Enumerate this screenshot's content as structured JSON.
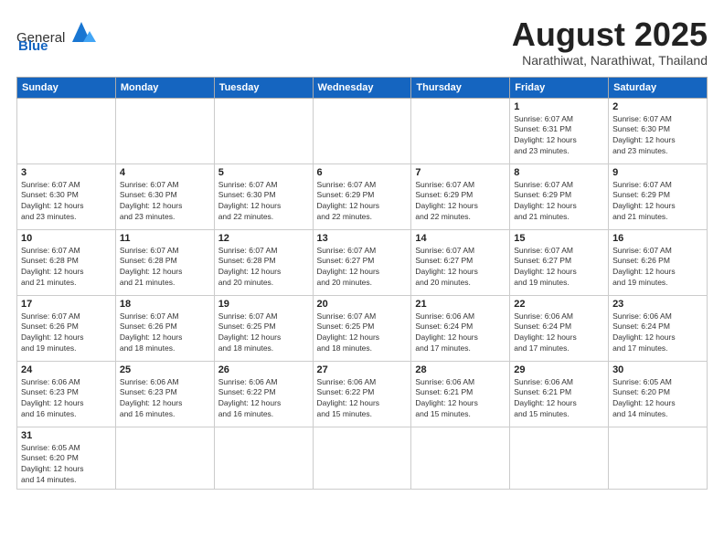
{
  "logo": {
    "text_general": "General",
    "text_blue": "Blue"
  },
  "title": {
    "month_year": "August 2025",
    "location": "Narathiwat, Narathiwat, Thailand"
  },
  "weekdays": [
    "Sunday",
    "Monday",
    "Tuesday",
    "Wednesday",
    "Thursday",
    "Friday",
    "Saturday"
  ],
  "weeks": [
    [
      {
        "day": "",
        "info": ""
      },
      {
        "day": "",
        "info": ""
      },
      {
        "day": "",
        "info": ""
      },
      {
        "day": "",
        "info": ""
      },
      {
        "day": "",
        "info": ""
      },
      {
        "day": "1",
        "info": "Sunrise: 6:07 AM\nSunset: 6:31 PM\nDaylight: 12 hours\nand 23 minutes."
      },
      {
        "day": "2",
        "info": "Sunrise: 6:07 AM\nSunset: 6:30 PM\nDaylight: 12 hours\nand 23 minutes."
      }
    ],
    [
      {
        "day": "3",
        "info": "Sunrise: 6:07 AM\nSunset: 6:30 PM\nDaylight: 12 hours\nand 23 minutes."
      },
      {
        "day": "4",
        "info": "Sunrise: 6:07 AM\nSunset: 6:30 PM\nDaylight: 12 hours\nand 23 minutes."
      },
      {
        "day": "5",
        "info": "Sunrise: 6:07 AM\nSunset: 6:30 PM\nDaylight: 12 hours\nand 22 minutes."
      },
      {
        "day": "6",
        "info": "Sunrise: 6:07 AM\nSunset: 6:29 PM\nDaylight: 12 hours\nand 22 minutes."
      },
      {
        "day": "7",
        "info": "Sunrise: 6:07 AM\nSunset: 6:29 PM\nDaylight: 12 hours\nand 22 minutes."
      },
      {
        "day": "8",
        "info": "Sunrise: 6:07 AM\nSunset: 6:29 PM\nDaylight: 12 hours\nand 21 minutes."
      },
      {
        "day": "9",
        "info": "Sunrise: 6:07 AM\nSunset: 6:29 PM\nDaylight: 12 hours\nand 21 minutes."
      }
    ],
    [
      {
        "day": "10",
        "info": "Sunrise: 6:07 AM\nSunset: 6:28 PM\nDaylight: 12 hours\nand 21 minutes."
      },
      {
        "day": "11",
        "info": "Sunrise: 6:07 AM\nSunset: 6:28 PM\nDaylight: 12 hours\nand 21 minutes."
      },
      {
        "day": "12",
        "info": "Sunrise: 6:07 AM\nSunset: 6:28 PM\nDaylight: 12 hours\nand 20 minutes."
      },
      {
        "day": "13",
        "info": "Sunrise: 6:07 AM\nSunset: 6:27 PM\nDaylight: 12 hours\nand 20 minutes."
      },
      {
        "day": "14",
        "info": "Sunrise: 6:07 AM\nSunset: 6:27 PM\nDaylight: 12 hours\nand 20 minutes."
      },
      {
        "day": "15",
        "info": "Sunrise: 6:07 AM\nSunset: 6:27 PM\nDaylight: 12 hours\nand 19 minutes."
      },
      {
        "day": "16",
        "info": "Sunrise: 6:07 AM\nSunset: 6:26 PM\nDaylight: 12 hours\nand 19 minutes."
      }
    ],
    [
      {
        "day": "17",
        "info": "Sunrise: 6:07 AM\nSunset: 6:26 PM\nDaylight: 12 hours\nand 19 minutes."
      },
      {
        "day": "18",
        "info": "Sunrise: 6:07 AM\nSunset: 6:26 PM\nDaylight: 12 hours\nand 18 minutes."
      },
      {
        "day": "19",
        "info": "Sunrise: 6:07 AM\nSunset: 6:25 PM\nDaylight: 12 hours\nand 18 minutes."
      },
      {
        "day": "20",
        "info": "Sunrise: 6:07 AM\nSunset: 6:25 PM\nDaylight: 12 hours\nand 18 minutes."
      },
      {
        "day": "21",
        "info": "Sunrise: 6:06 AM\nSunset: 6:24 PM\nDaylight: 12 hours\nand 17 minutes."
      },
      {
        "day": "22",
        "info": "Sunrise: 6:06 AM\nSunset: 6:24 PM\nDaylight: 12 hours\nand 17 minutes."
      },
      {
        "day": "23",
        "info": "Sunrise: 6:06 AM\nSunset: 6:24 PM\nDaylight: 12 hours\nand 17 minutes."
      }
    ],
    [
      {
        "day": "24",
        "info": "Sunrise: 6:06 AM\nSunset: 6:23 PM\nDaylight: 12 hours\nand 16 minutes."
      },
      {
        "day": "25",
        "info": "Sunrise: 6:06 AM\nSunset: 6:23 PM\nDaylight: 12 hours\nand 16 minutes."
      },
      {
        "day": "26",
        "info": "Sunrise: 6:06 AM\nSunset: 6:22 PM\nDaylight: 12 hours\nand 16 minutes."
      },
      {
        "day": "27",
        "info": "Sunrise: 6:06 AM\nSunset: 6:22 PM\nDaylight: 12 hours\nand 15 minutes."
      },
      {
        "day": "28",
        "info": "Sunrise: 6:06 AM\nSunset: 6:21 PM\nDaylight: 12 hours\nand 15 minutes."
      },
      {
        "day": "29",
        "info": "Sunrise: 6:06 AM\nSunset: 6:21 PM\nDaylight: 12 hours\nand 15 minutes."
      },
      {
        "day": "30",
        "info": "Sunrise: 6:05 AM\nSunset: 6:20 PM\nDaylight: 12 hours\nand 14 minutes."
      }
    ],
    [
      {
        "day": "31",
        "info": "Sunrise: 6:05 AM\nSunset: 6:20 PM\nDaylight: 12 hours\nand 14 minutes."
      },
      {
        "day": "",
        "info": ""
      },
      {
        "day": "",
        "info": ""
      },
      {
        "day": "",
        "info": ""
      },
      {
        "day": "",
        "info": ""
      },
      {
        "day": "",
        "info": ""
      },
      {
        "day": "",
        "info": ""
      }
    ]
  ]
}
